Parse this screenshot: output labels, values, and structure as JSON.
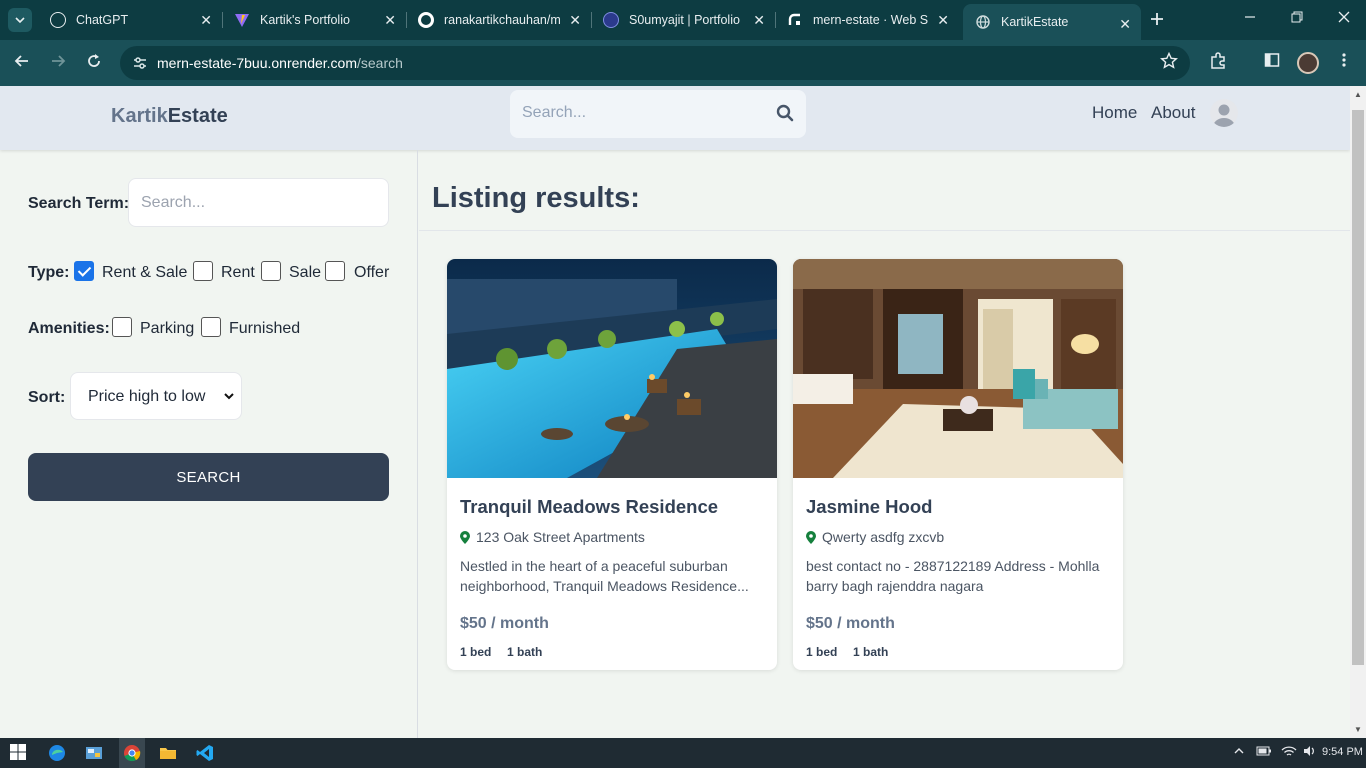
{
  "browser": {
    "tabs": [
      {
        "title": "ChatGPT",
        "icon": "chatgpt-icon"
      },
      {
        "title": "Kartik's Portfolio",
        "icon": "vite-icon"
      },
      {
        "title": "ranakartikchauhan/m",
        "icon": "github-icon"
      },
      {
        "title": "S0umyajit | Portfolio",
        "icon": "portfolio-icon"
      },
      {
        "title": "mern-estate · Web S",
        "icon": "render-icon"
      },
      {
        "title": "KartikEstate",
        "icon": "globe-icon"
      }
    ],
    "active_tab": 5,
    "url_host": "mern-estate-7buu.onrender.com",
    "url_path": "/search"
  },
  "header": {
    "logo_part1": "Kartik",
    "logo_part2": "Estate",
    "search_placeholder": "Search...",
    "nav_home": "Home",
    "nav_about": "About"
  },
  "sidebar": {
    "search_term_label": "Search Term:",
    "search_term_placeholder": "Search...",
    "type_label": "Type:",
    "type_options": [
      {
        "label": "Rent & Sale",
        "checked": true
      },
      {
        "label": "Rent",
        "checked": false
      },
      {
        "label": "Sale",
        "checked": false
      },
      {
        "label": "Offer",
        "checked": false
      }
    ],
    "amenities_label": "Amenities:",
    "amenities_options": [
      {
        "label": "Parking",
        "checked": false
      },
      {
        "label": "Furnished",
        "checked": false
      }
    ],
    "sort_label": "Sort:",
    "sort_value": "Price high to low",
    "search_button": "SEARCH"
  },
  "results": {
    "title": "Listing results:",
    "listings": [
      {
        "name": "Tranquil Meadows Residence",
        "address": "123 Oak Street Apartments",
        "description": "Nestled in the heart of a peaceful suburban neighborhood, Tranquil Meadows Residence...",
        "price": "$50 / month",
        "beds": "1 bed",
        "baths": "1 bath"
      },
      {
        "name": "Jasmine Hood",
        "address": "Qwerty asdfg zxcvb",
        "description": "best contact no - 2887122189 Address - Mohlla barry bagh rajenddra nagara",
        "price": "$50 / month",
        "beds": "1 bed",
        "baths": "1 bath"
      }
    ]
  },
  "taskbar": {
    "time": "9:54 PM"
  },
  "colors": {
    "chrome_dark": "#0d3c42",
    "chrome_toolbar": "#1a5058",
    "header_bg": "#e2e8f0",
    "slate": "#334155",
    "pin_green": "#15803d"
  }
}
